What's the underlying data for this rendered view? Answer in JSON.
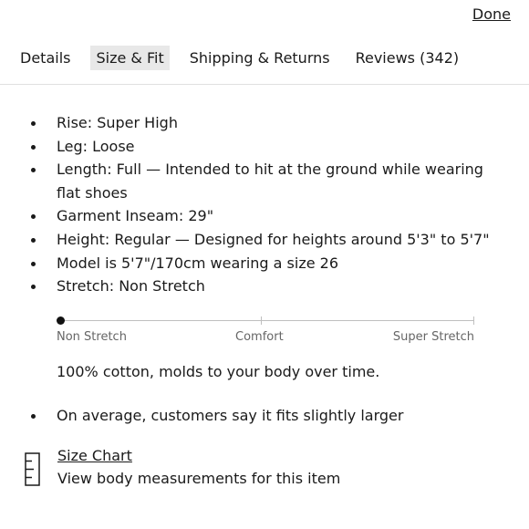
{
  "header": {
    "done_label": "Done"
  },
  "tabs": [
    {
      "label": "Details",
      "active": false
    },
    {
      "label": "Size & Fit",
      "active": true
    },
    {
      "label": "Shipping & Returns",
      "active": false
    },
    {
      "label": "Reviews (342)",
      "active": false
    }
  ],
  "fit_details": [
    "Rise: Super High",
    "Leg: Loose",
    "Length: Full — Intended to hit at the ground while wearing flat shoes",
    "Garment Inseam: 29\"",
    "Height: Regular — Designed for heights around 5'3\" to 5'7\"",
    "Model is 5'7\"/170cm wearing a size 26",
    "Stretch: Non Stretch"
  ],
  "stretch_scale": {
    "labels": [
      "Non Stretch",
      "Comfort",
      "Super Stretch"
    ],
    "value_fraction": 0
  },
  "fabric_note": "100% cotton, molds to your body over time.",
  "fit_feedback": [
    "On average, customers say it fits slightly larger"
  ],
  "size_chart": {
    "link_label": "Size Chart",
    "description": "View body measurements for this item",
    "icon": "ruler-icon"
  },
  "colors": {
    "active_tab_bg": "#e8e8e8",
    "text": "#1a1a1a",
    "muted": "#666666"
  }
}
